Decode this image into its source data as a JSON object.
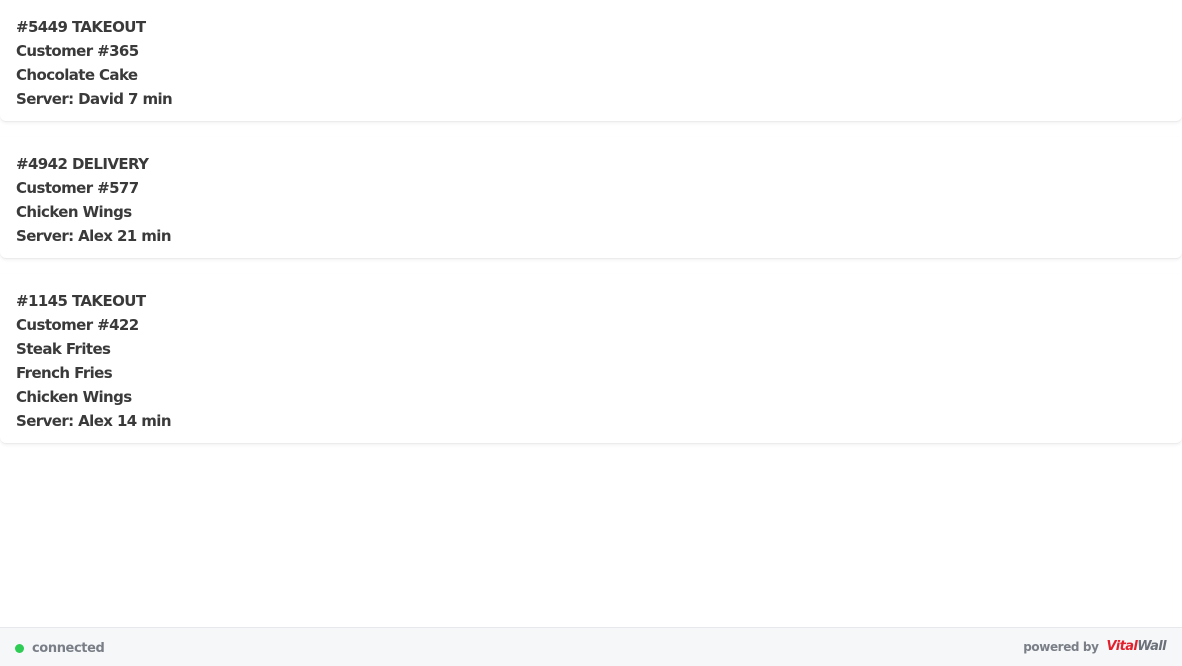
{
  "orders": [
    {
      "header": "#5449 TAKEOUT",
      "customer": "Customer #365",
      "items": [
        "Chocolate Cake"
      ],
      "server": "Server: David 7 min"
    },
    {
      "header": "#4942 DELIVERY",
      "customer": "Customer #577",
      "items": [
        "Chicken Wings"
      ],
      "server": "Server: Alex 21 min"
    },
    {
      "header": "#1145 TAKEOUT",
      "customer": "Customer #422",
      "items": [
        "Steak Frites",
        "French Fries",
        "Chicken Wings"
      ],
      "server": "Server: Alex 14 min"
    }
  ],
  "footer": {
    "status_text": "connected",
    "status_color": "#2ecc55",
    "powered_by": "powered by",
    "logo_part1": "Vital",
    "logo_part2": "Wall",
    "logo_color1": "#e2202c",
    "logo_color2": "#6b7079"
  }
}
